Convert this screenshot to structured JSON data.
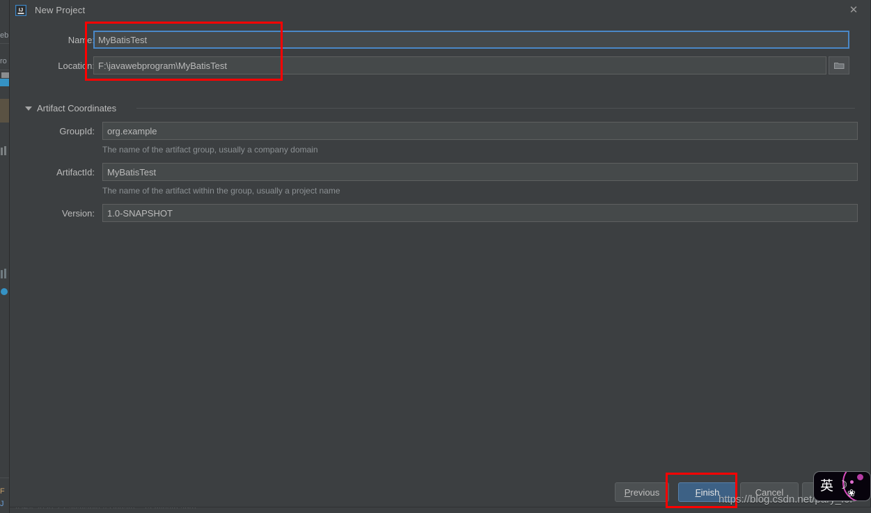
{
  "window": {
    "title": "New Project",
    "icon": "intellij-idea-logo-icon",
    "close_label": "✕"
  },
  "form": {
    "name": {
      "label": "Name:",
      "value": "MyBatisTest"
    },
    "location": {
      "label": "Location:",
      "value": "F:\\javawebprogram\\MyBatisTest",
      "browse_icon": "folder-icon"
    },
    "section": {
      "title": "Artifact Coordinates",
      "expanded_icon": "triangle-down-icon"
    },
    "group_id": {
      "label": "GroupId:",
      "value": "org.example",
      "help": "The name of the artifact group, usually a company domain"
    },
    "artifact_id": {
      "label": "ArtifactId:",
      "value": "MyBatisTest",
      "help": "The name of the artifact within the group, usually a project name"
    },
    "version": {
      "label": "Version:",
      "value": "1.0-SNAPSHOT"
    }
  },
  "buttons": {
    "previous": {
      "prefix": "P",
      "rest": "revious"
    },
    "finish": {
      "prefix": "F",
      "rest": "inish"
    },
    "cancel": {
      "label": "Cancel"
    }
  },
  "watermark": {
    "text": "https://blog.csdn.net/pary_for"
  },
  "ime": {
    "language": "英",
    "moon_icon": "☽",
    "butterfly_icon": "❀"
  },
  "colors": {
    "dialog_bg": "#3c3f41",
    "field_bg": "#45494a",
    "focus_border": "#4a88c7",
    "primary_button": "#3d6185",
    "annotation": "#ff0000",
    "text": "#bbbbbb",
    "help_text": "#8c9194"
  }
}
